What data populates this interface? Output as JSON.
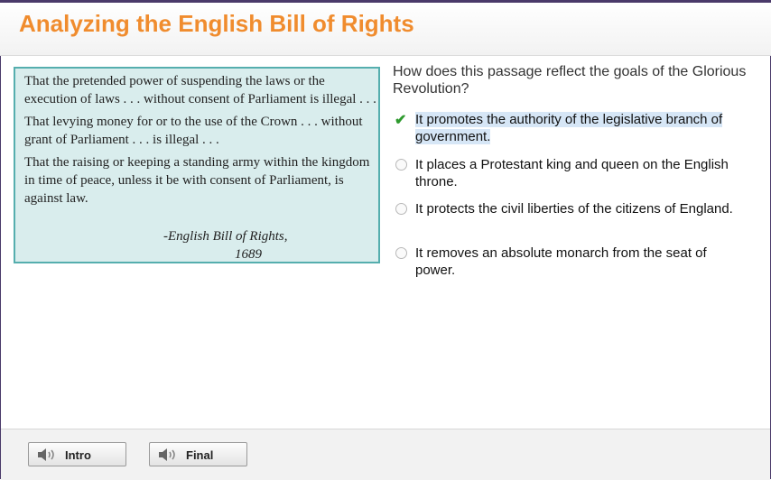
{
  "header": {
    "title": "Analyzing the English Bill of Rights"
  },
  "passage": {
    "paragraphs": [
      "That the pretended power of suspending the laws or the execution of laws . . . without consent of Parliament is illegal . . .",
      "That levying money for or to the use of the Crown . . . without grant of Parliament . . . is illegal . . .",
      "That the raising or keeping a standing army within the kingdom in time of peace, unless it be with consent of Parliament, is against law."
    ],
    "citation_line1": "-English Bill of Rights,",
    "citation_line2": "1689"
  },
  "question": {
    "text": "How does this passage reflect the goals of the Glorious Revolution?"
  },
  "options": [
    {
      "text": "It promotes the authority of the legislative branch of government.",
      "selected": true
    },
    {
      "text": "It places a Protestant king and queen on the English throne.",
      "selected": false
    },
    {
      "text": "It protects the civil liberties of the citizens of England.",
      "selected": false
    },
    {
      "text": "It removes an absolute monarch from the seat of power.",
      "selected": false
    }
  ],
  "footer": {
    "intro_label": "Intro",
    "final_label": "Final",
    "speaker_icon": "speaker-icon"
  },
  "colors": {
    "title": "#f08c2e",
    "passage_bg": "#d9eded",
    "passage_border": "#55aeae",
    "check": "#2e9a2e",
    "selection_highlight": "#d6e6f6"
  }
}
